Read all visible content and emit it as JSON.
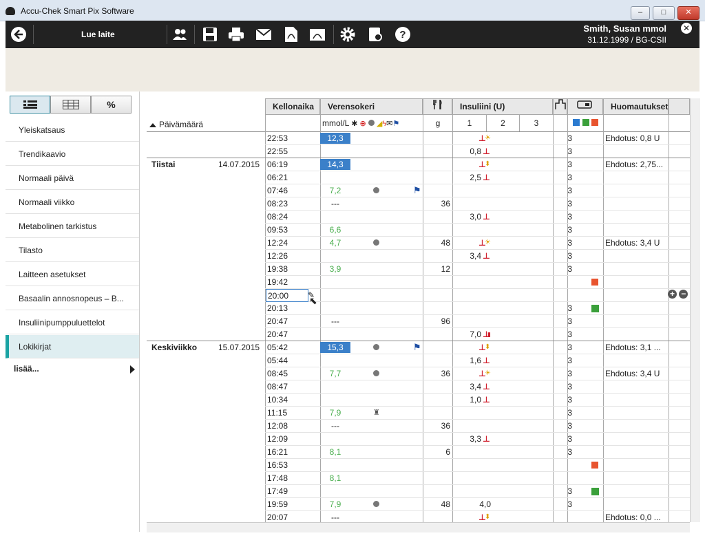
{
  "window": {
    "title": "Accu-Chek Smart Pix Software"
  },
  "toolbar": {
    "read_device": "Lue laite",
    "patient_name": "Smith, Susan mmol",
    "patient_details": "31.12.1999 / BG-CSII"
  },
  "sidebar": {
    "view_tabs": [
      "list",
      "table",
      "%"
    ],
    "items": [
      {
        "label": "Yleiskatsaus"
      },
      {
        "label": "Trendikaavio"
      },
      {
        "label": "Normaali päivä"
      },
      {
        "label": "Normaali viikko"
      },
      {
        "label": "Metabolinen tarkistus"
      },
      {
        "label": "Tilasto"
      },
      {
        "label": "Laitteen asetukset"
      },
      {
        "label": "Basaalin annosnopeus – B..."
      },
      {
        "label": "Insuliinipumppuluettelot"
      },
      {
        "label": "Lokikirjat"
      }
    ],
    "more": "lisää..."
  },
  "grid": {
    "headers": {
      "time": "Kellonaika",
      "bg": "Verensokeri",
      "insulin": "Insuliini (U)",
      "notes": "Huomautukset",
      "date": "Päivämäärä",
      "bg_unit": "mmol/L",
      "carb_unit": "g",
      "ins1": "1",
      "ins2": "2",
      "ins3": "3"
    },
    "days": [
      {
        "name": "Tiistai",
        "date": "14.07.2015"
      },
      {
        "name": "Keskiviikko",
        "date": "15.07.2015"
      }
    ],
    "rows": [
      {
        "t": "22:53",
        "bg": "12,3",
        "bgHigh": true,
        "ins": "",
        "bolus": "sun",
        "basal": "3",
        "note": "Ehdotus: 0,8 U"
      },
      {
        "t": "22:55",
        "ins": "0,8",
        "bolus": "std",
        "basal": "3"
      },
      {
        "t": "06:19",
        "bg": "14,3",
        "bgHigh": true,
        "bolus": "arrow",
        "basal": "3",
        "note": "Ehdotus: 2,75..."
      },
      {
        "t": "06:21",
        "ins": "2,5",
        "bolus": "std",
        "basal": "3"
      },
      {
        "t": "07:46",
        "bg": "7,2",
        "apple": true,
        "flag": true,
        "basal": "3"
      },
      {
        "t": "08:23",
        "bg": "---",
        "carb": "36",
        "basal": "3"
      },
      {
        "t": "08:24",
        "ins": "3,0",
        "bolus": "std",
        "basal": "3"
      },
      {
        "t": "09:53",
        "bg": "6,6",
        "basal": "3"
      },
      {
        "t": "12:24",
        "bg": "4,7",
        "apple": true,
        "carb": "48",
        "bolus": "sun",
        "basal": "3",
        "note": "Ehdotus: 3,4 U"
      },
      {
        "t": "12:26",
        "ins": "3,4",
        "bolus": "std",
        "basal": "3"
      },
      {
        "t": "19:38",
        "bg": "3,9",
        "carb": "12",
        "basal": "3"
      },
      {
        "t": "19:42",
        "stop": true
      },
      {
        "t": "20:00",
        "edit": true
      },
      {
        "t": "20:13",
        "basal": "3",
        "run": true
      },
      {
        "t": "20:47",
        "bg": "---",
        "carb": "96",
        "basal": "3"
      },
      {
        "t": "20:47",
        "ins": "7,0",
        "bolus": "ext",
        "basal": "3"
      },
      {
        "t": "05:42",
        "bg": "15,3",
        "bgHigh": true,
        "apple": true,
        "flag": true,
        "bolus": "arrow",
        "basal": "3",
        "note": "Ehdotus: 3,1 ..."
      },
      {
        "t": "05:44",
        "ins": "1,6",
        "bolus": "std",
        "basal": "3"
      },
      {
        "t": "08:45",
        "bg": "7,7",
        "apple": true,
        "carb": "36",
        "bolus": "sun",
        "basal": "3",
        "note": "Ehdotus: 3,4 U"
      },
      {
        "t": "08:47",
        "ins": "3,4",
        "bolus": "std",
        "basal": "3"
      },
      {
        "t": "10:34",
        "ins": "1,0",
        "bolus": "std",
        "basal": "3"
      },
      {
        "t": "11:15",
        "bg": "7,9",
        "bed": true,
        "basal": "3"
      },
      {
        "t": "12:08",
        "bg": "---",
        "carb": "36",
        "basal": "3"
      },
      {
        "t": "12:09",
        "ins": "3,3",
        "bolus": "std",
        "basal": "3"
      },
      {
        "t": "16:21",
        "bg": "8,1",
        "carb": "6",
        "basal": "3"
      },
      {
        "t": "16:53",
        "stop": true
      },
      {
        "t": "17:48",
        "bg": "8,1"
      },
      {
        "t": "17:49",
        "basal": "3",
        "run": true
      },
      {
        "t": "19:59",
        "bg": "7,9",
        "apple": true,
        "carb": "48",
        "insPlain": "4,0",
        "basal": "3"
      },
      {
        "t": "20:07",
        "bg": "---",
        "bolus": "arrow",
        "note": "Ehdotus: 0,0 ..."
      }
    ]
  },
  "colors": {
    "toolbar": "#222222",
    "accent": "#1aa3a3",
    "bg_high": "#3b80c9",
    "bg_normal": "#4caf50"
  }
}
